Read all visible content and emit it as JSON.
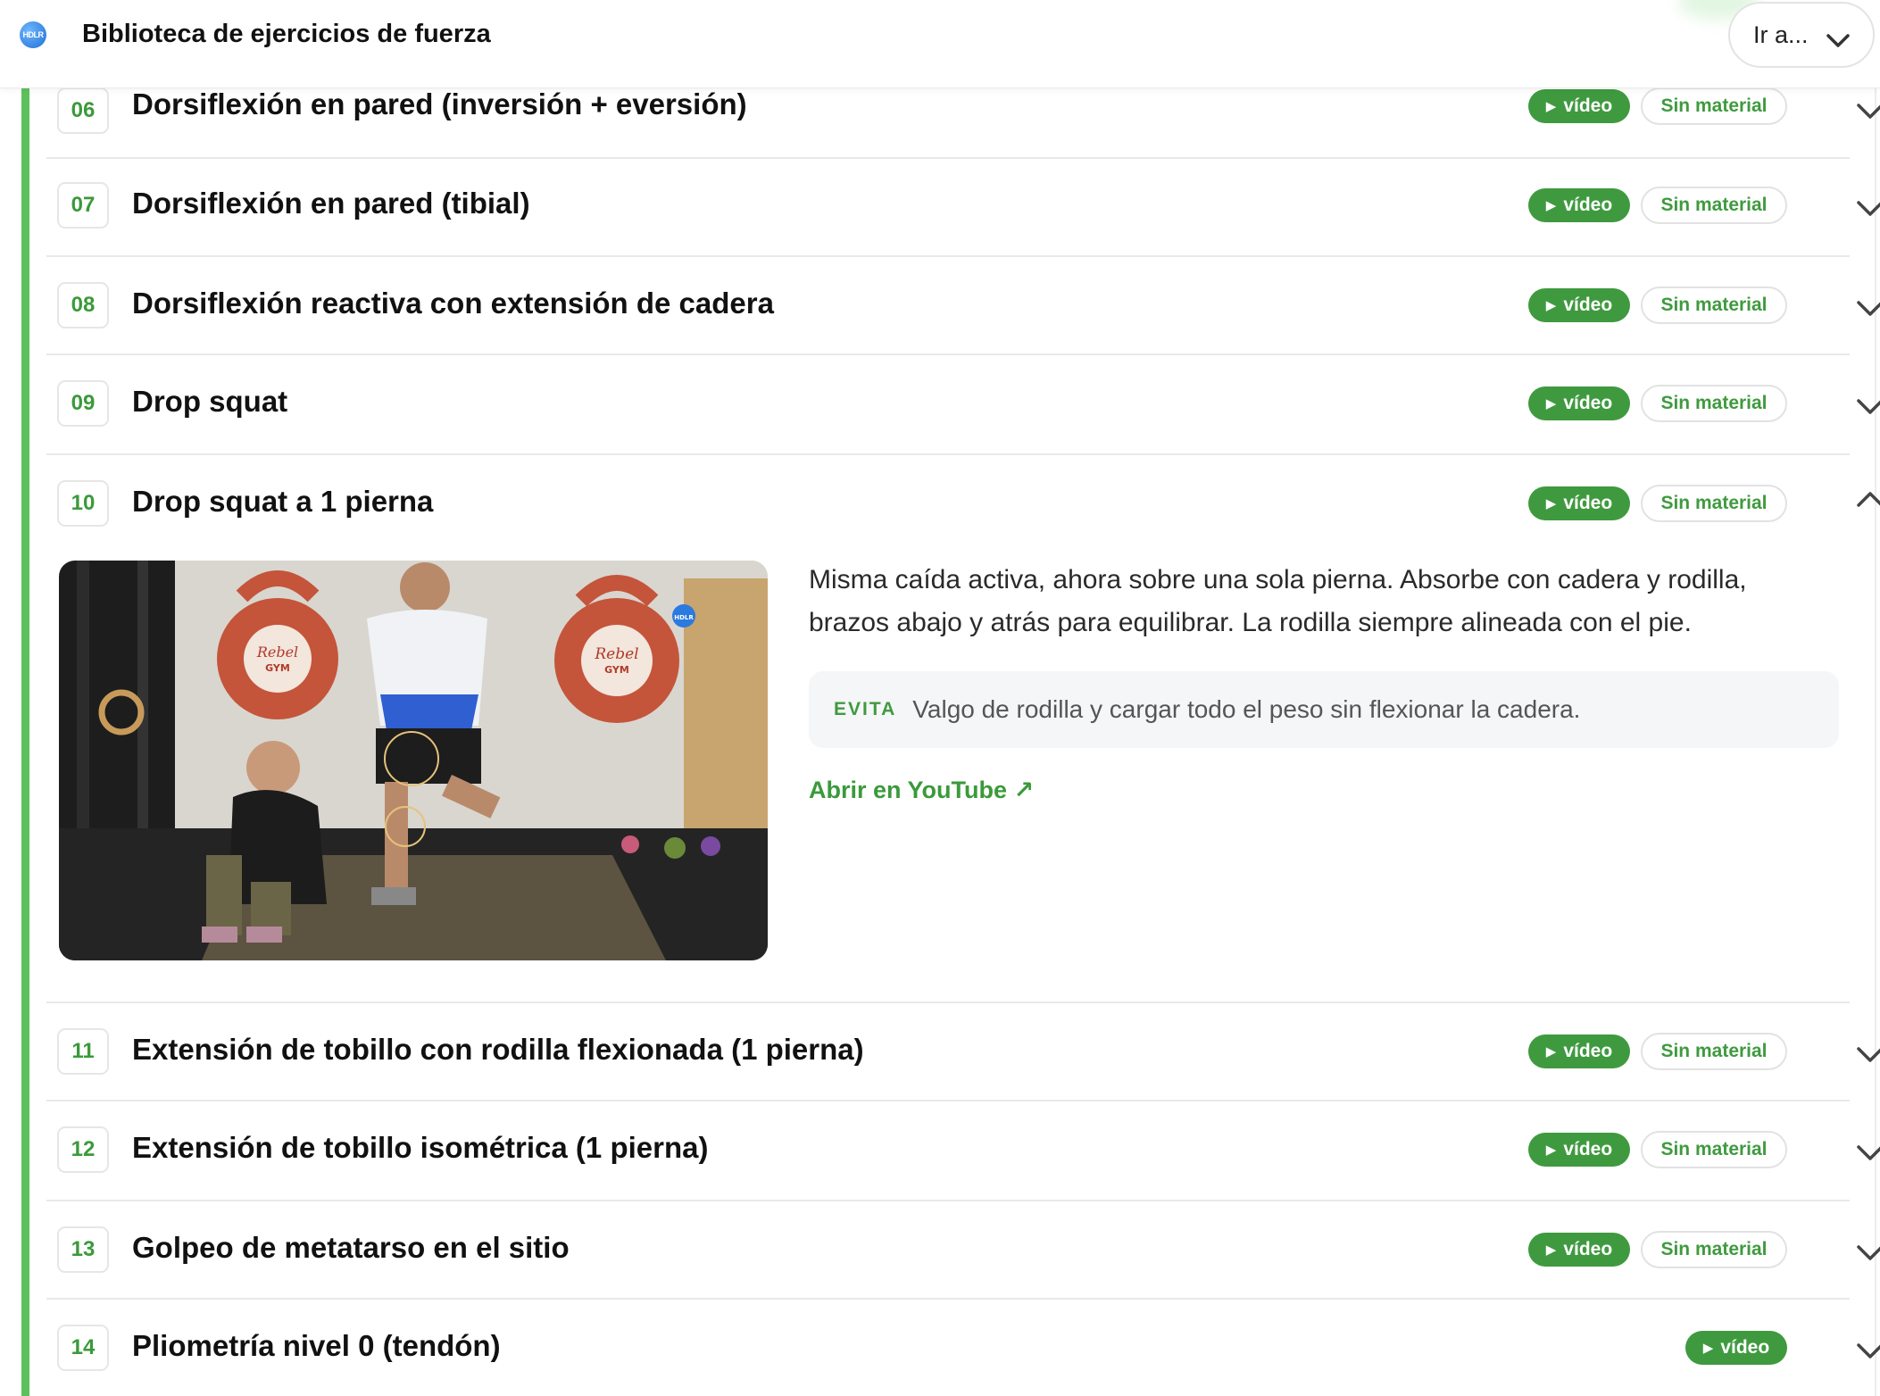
{
  "header": {
    "title": "Biblioteca de ejercicios de fuerza",
    "logo_text": "HDLR",
    "goto_label": "Ir a..."
  },
  "common": {
    "video_label": "vídeo",
    "material_label": "Sin material"
  },
  "exercises": [
    {
      "num": "06",
      "title": "Dorsiflexión en pared (inversión + eversión)"
    },
    {
      "num": "07",
      "title": "Dorsiflexión en pared (tibial)"
    },
    {
      "num": "08",
      "title": "Dorsiflexión reactiva con extensión de cadera"
    },
    {
      "num": "09",
      "title": "Drop squat"
    },
    {
      "num": "10",
      "title": "Drop squat a 1 pierna"
    },
    {
      "num": "11",
      "title": "Extensión de tobillo con rodilla flexionada (1 pierna)"
    },
    {
      "num": "12",
      "title": "Extensión de tobillo isométrica (1 pierna)"
    },
    {
      "num": "13",
      "title": "Golpeo de metatarso en el sitio"
    },
    {
      "num": "14",
      "title": "Pliometría nivel 0 (tendón)"
    }
  ],
  "expanded": {
    "description": "Misma caída activa, ahora sobre una sola pierna. Absorbe con cadera y rodilla, brazos abajo y atrás para equilibrar. La rodilla siempre alineada con el pie.",
    "avoid_label": "EVITA",
    "avoid_text": "Valgo de rodilla y cargar todo el peso sin flexionar la cadera.",
    "youtube_label": "Abrir en YouTube ↗",
    "kettlebell_text_1": "Rebel",
    "kettlebell_text_2": "GYM",
    "thumb_logo_text": "HDLR"
  },
  "colors": {
    "accent": "#3f9a3f",
    "rail": "#5cc15c"
  }
}
